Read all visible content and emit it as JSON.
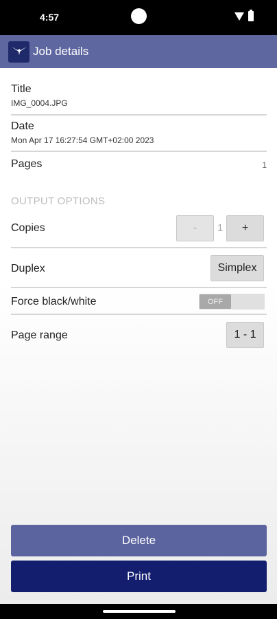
{
  "status_bar": {
    "time": "4:57"
  },
  "app_bar": {
    "title": "Job details",
    "logo_icon": "bird-icon"
  },
  "job": {
    "title_label": "Title",
    "title_value": "IMG_0004.JPG",
    "date_label": "Date",
    "date_value": "Mon Apr 17 16:27:54 GMT+02:00 2023",
    "pages_label": "Pages",
    "pages_value": "1"
  },
  "output_options": {
    "section_title": "OUTPUT OPTIONS",
    "copies_label": "Copies",
    "copies_minus": "-",
    "copies_value": "1",
    "copies_plus": "+",
    "duplex_label": "Duplex",
    "duplex_value": "Simplex",
    "force_bw_label": "Force black/white",
    "force_bw_state": "OFF",
    "page_range_label": "Page range",
    "page_range_value": "1 - 1"
  },
  "actions": {
    "delete_label": "Delete",
    "print_label": "Print"
  },
  "colors": {
    "app_bar": "#5f67a0",
    "delete": "#5c64a0",
    "print": "#141e6e"
  }
}
